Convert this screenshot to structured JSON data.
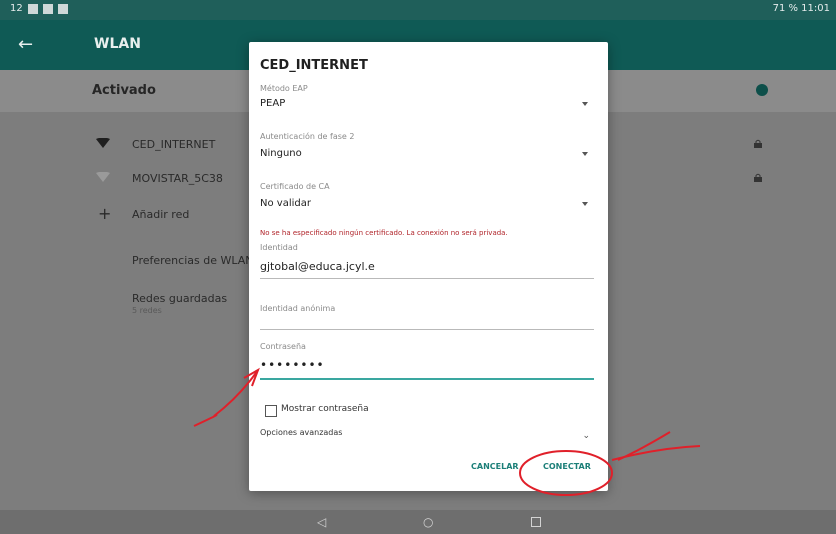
{
  "status_bar": {
    "time_left": "12",
    "right_text": "71 % 11:01"
  },
  "app_bar": {
    "back_icon": "arrow-left-icon",
    "title": "WLAN"
  },
  "activated": {
    "label": "Activado",
    "toggle_state": "on",
    "toggle_color": "#0d4f4a"
  },
  "list": {
    "networks": [
      {
        "name": "CED_INTERNET",
        "locked": true
      },
      {
        "name": "MOVISTAR_5C38",
        "locked": true
      }
    ],
    "add_network": "Añadir red",
    "preferences": "Preferencias de WLAN",
    "saved": {
      "label": "Redes guardadas",
      "sub": "5 redes"
    }
  },
  "dialog": {
    "title": "CED_INTERNET",
    "eap_method": {
      "caption": "Método EAP",
      "value": "PEAP"
    },
    "phase2": {
      "caption": "Autenticación de fase 2",
      "value": "Ninguno"
    },
    "ca_cert": {
      "caption": "Certificado de CA",
      "value": "No validar"
    },
    "warning": "No se ha especificado ningún certificado. La conexión no será privada.",
    "identity": {
      "caption": "Identidad",
      "value": "gjtobal@educa.jcyl.e"
    },
    "anon_identity": {
      "caption": "Identidad anónima",
      "value": ""
    },
    "password": {
      "caption": "Contraseña",
      "value": "••••••••"
    },
    "show_password": "Mostrar contraseña",
    "advanced": "Opciones avanzadas",
    "cancel": "CANCELAR",
    "connect": "CONECTAR"
  },
  "colors": {
    "accent": "#1c7f78",
    "warning": "#b0242a",
    "annotation": "#e0202a"
  }
}
